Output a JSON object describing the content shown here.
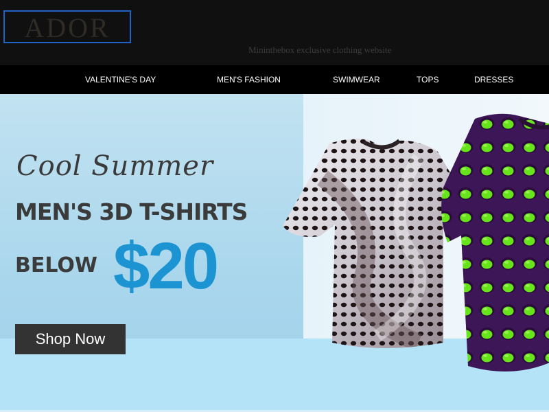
{
  "header": {
    "logo_text": "ADOR",
    "tagline": "Mininthebox exclusive clothing website"
  },
  "nav": {
    "items": [
      {
        "label": "VALENTINE'S DAY"
      },
      {
        "label": "MEN'S FASHION"
      },
      {
        "label": "SWIMWEAR"
      },
      {
        "label": "TOPS"
      },
      {
        "label": "DRESSES"
      }
    ]
  },
  "banner": {
    "script_line": "Cool Summer",
    "title": "MEN'S 3D T-SHIRTS",
    "below_label": "BELOW",
    "price": "$20",
    "cta_label": "Shop Now",
    "colors": {
      "price": "#1c94d2",
      "button": "#333333",
      "background": "#a9d6ec"
    },
    "products": [
      {
        "icon": "tshirt-icon",
        "pattern": "white-3d-wave"
      },
      {
        "icon": "tshirt-icon",
        "pattern": "purple-green-3d-holes"
      }
    ]
  }
}
